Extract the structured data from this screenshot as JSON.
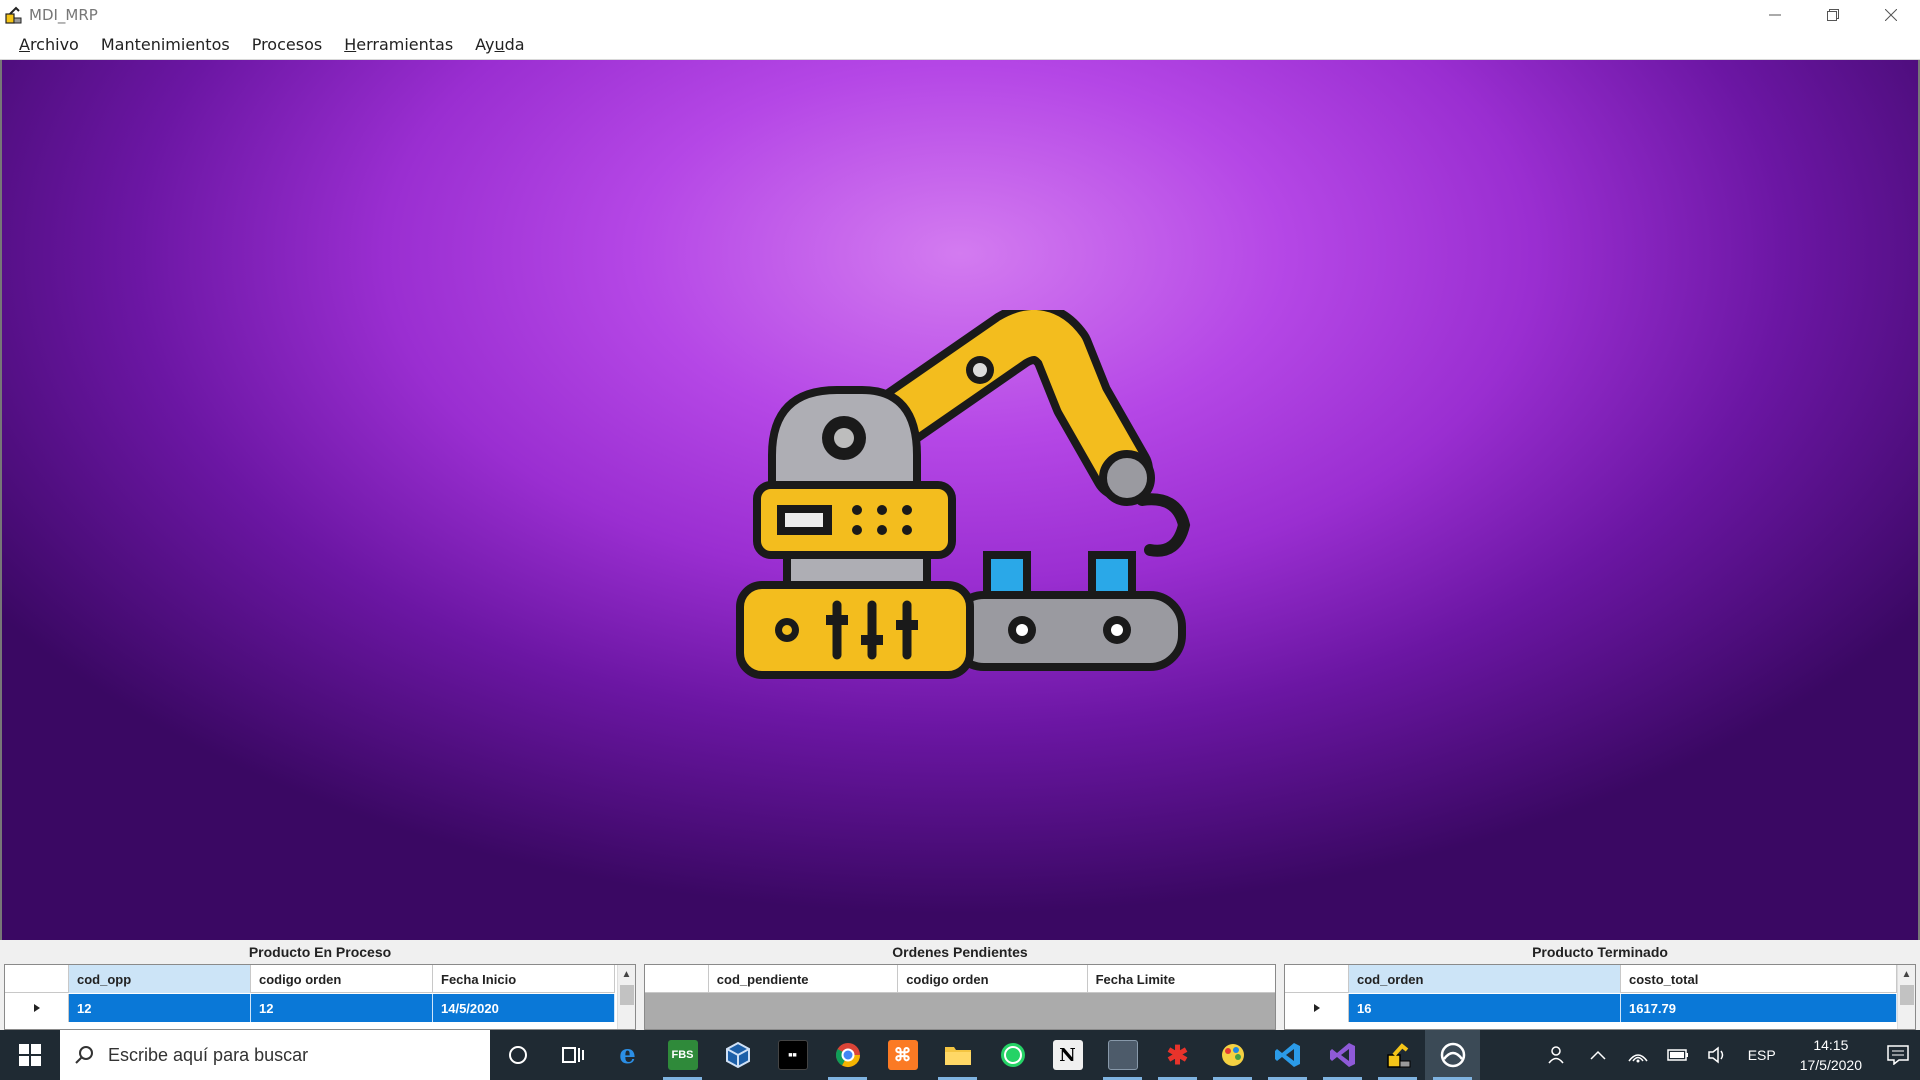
{
  "window": {
    "title": "MDI_MRP",
    "controls": [
      "minimize",
      "restore",
      "close"
    ]
  },
  "menu": [
    {
      "label_u": "A",
      "label_rest": "rchivo"
    },
    {
      "label_u": "",
      "label_rest": "Mantenimientos"
    },
    {
      "label_u": "",
      "label_rest": "Procesos"
    },
    {
      "label_u": "H",
      "label_rest": "erramientas"
    },
    {
      "label_pre": "Ay",
      "label_u": "u",
      "label_rest": "da"
    }
  ],
  "menu_labels": {
    "archivo_u": "A",
    "archivo_rest": "rchivo",
    "mantenimientos": "Mantenimientos",
    "procesos": "Procesos",
    "herramientas_u": "H",
    "herramientas_rest": "erramientas",
    "ayuda_pre": "Ay",
    "ayuda_u": "u",
    "ayuda_rest": "da"
  },
  "background": {
    "image": "robot-arm-factory-icon",
    "colors": {
      "center": "#d37bf0",
      "mid": "#9a2ed1",
      "edge": "#3a0863"
    }
  },
  "panels": {
    "en_proceso": {
      "title": "Producto En Proceso",
      "columns": [
        "cod_opp",
        "codigo orden",
        "Fecha Inicio"
      ],
      "rows": [
        [
          "12",
          "12",
          "14/5/2020"
        ]
      ]
    },
    "pendientes": {
      "title": "Ordenes Pendientes",
      "columns": [
        "cod_pendiente",
        "codigo orden",
        "Fecha Limite"
      ],
      "rows": []
    },
    "terminado": {
      "title": "Producto Terminado",
      "columns": [
        "cod_orden",
        "costo_total"
      ],
      "rows": [
        [
          "16",
          "1617.79"
        ]
      ]
    }
  },
  "taskbar": {
    "search_placeholder": "Escribe aquí para buscar",
    "apps": [
      "cortana-icon",
      "task-view-icon",
      "edge-icon",
      "fbs-icon",
      "virtualbox-icon",
      "terminal-icon",
      "chrome-icon",
      "xampp-icon",
      "file-explorer-icon",
      "whatsapp-icon",
      "notion-icon",
      "app-icon",
      "red-app-icon",
      "paint-icon",
      "vscode-icon",
      "visual-studio-icon",
      "mdi-mrp-icon",
      "active-app-icon"
    ],
    "fbs_label": "FBS",
    "language": "ESP",
    "time": "14:15",
    "date": "17/5/2020"
  }
}
